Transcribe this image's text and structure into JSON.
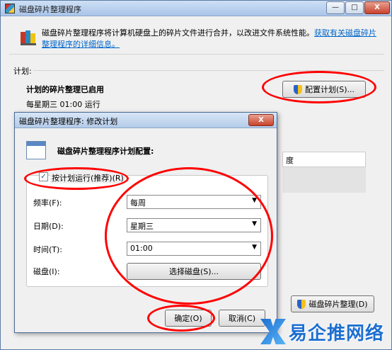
{
  "main_window": {
    "title": "磁盘碎片整理程序",
    "caption": {
      "minimize": "—",
      "maximize": "□",
      "close": "X"
    },
    "intro_text": "磁盘碎片整理程序将计算机硬盘上的碎片文件进行合并，以改进文件系统性能。",
    "intro_link": "获取有关磁盘碎片整理程序的详细信息。",
    "schedule_label": "计划:",
    "schedule_status": "计划的碎片整理已启用",
    "schedule_detail": "每星期三 01:00 运行",
    "configure_button": "配置计划(S)...",
    "list_header": "度",
    "defrag_button": "磁盘碎片整理(D)"
  },
  "dialog": {
    "title": "磁盘碎片整理程序: 修改计划",
    "close": "X",
    "heading": "磁盘碎片整理程序计划配置:",
    "run_on_schedule_label": "按计划运行(推荐)(R)",
    "run_on_schedule_checked": true,
    "check_mark": "✓",
    "frequency_label": "频率(F):",
    "frequency_value": "每周",
    "day_label": "日期(D):",
    "day_value": "星期三",
    "time_label": "时间(T):",
    "time_value": "01:00",
    "disk_label": "磁盘(I):",
    "select_disks_button": "选择磁盘(S)...",
    "ok_button": "确定(O)",
    "cancel_button": "取消(C)",
    "dropdown_arrow": "▼"
  },
  "watermark": {
    "text": "易企推网络"
  },
  "colors": {
    "annotation": "#ff0000",
    "link": "#0066cc",
    "title_gradient": "#a9c4e8"
  }
}
